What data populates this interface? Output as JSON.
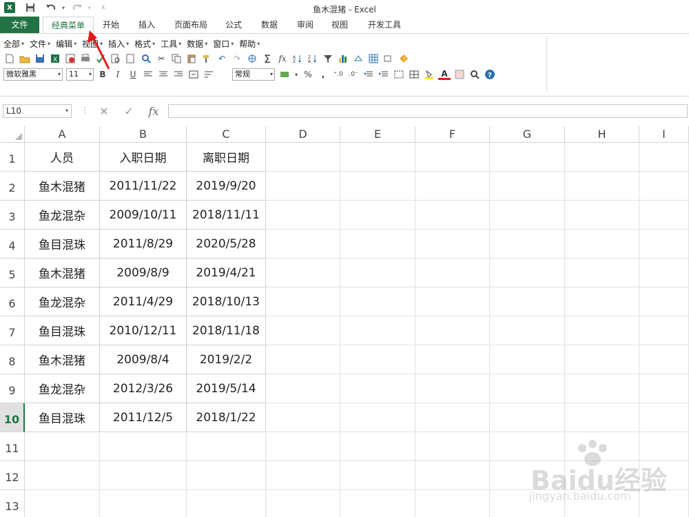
{
  "window": {
    "title": "鱼木混猪 - Excel"
  },
  "quick_access": {
    "excel_logo": "X",
    "save_icon": "save-icon",
    "undo_icon": "undo-icon",
    "redo_icon": "redo-icon"
  },
  "tabs": [
    {
      "label": "文件"
    },
    {
      "label": "经典菜单"
    },
    {
      "label": "开始"
    },
    {
      "label": "插入"
    },
    {
      "label": "页面布局"
    },
    {
      "label": "公式"
    },
    {
      "label": "数据"
    },
    {
      "label": "审阅"
    },
    {
      "label": "视图"
    },
    {
      "label": "开发工具"
    }
  ],
  "menus": [
    {
      "label": "全部"
    },
    {
      "label": "文件"
    },
    {
      "label": "编辑"
    },
    {
      "label": "视图"
    },
    {
      "label": "插入"
    },
    {
      "label": "格式"
    },
    {
      "label": "工具"
    },
    {
      "label": "数据"
    },
    {
      "label": "窗口"
    },
    {
      "label": "帮助"
    }
  ],
  "formatting": {
    "font_name": "微软雅黑",
    "font_size": "11",
    "bold": "B",
    "italic": "I",
    "underline": "U",
    "number_format": "常规",
    "percent": "%",
    "comma": ",",
    "font_color_letter": "A",
    "accent": "#217346"
  },
  "formula_bar": {
    "name_box": "L10",
    "fx_label": "fx",
    "formula": ""
  },
  "columns": [
    "A",
    "B",
    "C",
    "D",
    "E",
    "F",
    "G",
    "H",
    "I"
  ],
  "rows": [
    "1",
    "2",
    "3",
    "4",
    "5",
    "6",
    "7",
    "8",
    "9",
    "10",
    "11",
    "12",
    "13"
  ],
  "table": {
    "headers": [
      "人员",
      "入职日期",
      "离职日期"
    ],
    "rows": [
      [
        "鱼木混猪",
        "2011/11/22",
        "2019/9/20"
      ],
      [
        "鱼龙混杂",
        "2009/10/11",
        "2018/11/11"
      ],
      [
        "鱼目混珠",
        "2011/8/29",
        "2020/5/28"
      ],
      [
        "鱼木混猪",
        "2009/8/9",
        "2019/4/21"
      ],
      [
        "鱼龙混杂",
        "2011/4/29",
        "2018/10/13"
      ],
      [
        "鱼目混珠",
        "2010/12/11",
        "2018/11/18"
      ],
      [
        "鱼木混猪",
        "2009/8/4",
        "2019/2/2"
      ],
      [
        "鱼龙混杂",
        "2012/3/26",
        "2019/5/14"
      ],
      [
        "鱼目混珠",
        "2011/12/5",
        "2018/1/22"
      ]
    ]
  },
  "watermark": {
    "brand": "Baidu经验",
    "url": "jingyan.baidu.com"
  }
}
